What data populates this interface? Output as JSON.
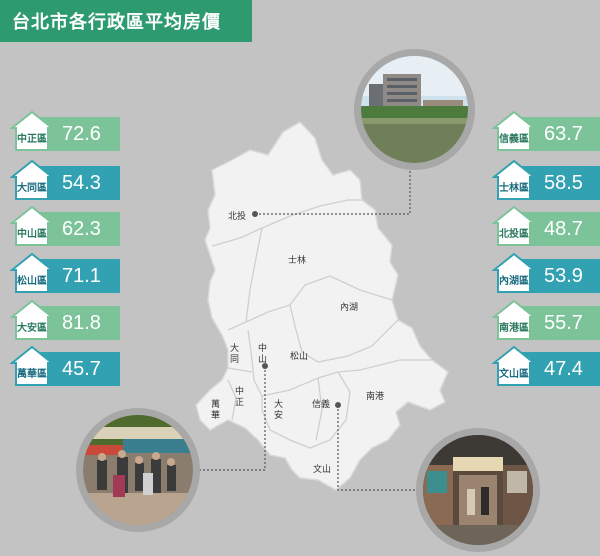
{
  "title": "台北市各行政區平均房價",
  "left_items": [
    {
      "name": "中正區",
      "value": "72.6",
      "color": "#7cc39a"
    },
    {
      "name": "大同區",
      "value": "54.3",
      "color": "#32a1b1"
    },
    {
      "name": "中山區",
      "value": "62.3",
      "color": "#7cc39a"
    },
    {
      "name": "松山區",
      "value": "71.1",
      "color": "#32a1b1"
    },
    {
      "name": "大安區",
      "value": "81.8",
      "color": "#7cc39a"
    },
    {
      "name": "萬華區",
      "value": "45.7",
      "color": "#32a1b1"
    }
  ],
  "right_items": [
    {
      "name": "信義區",
      "value": "63.7",
      "color": "#7cc39a"
    },
    {
      "name": "士林區",
      "value": "58.5",
      "color": "#32a1b1"
    },
    {
      "name": "北投區",
      "value": "48.7",
      "color": "#7cc39a"
    },
    {
      "name": "內湖區",
      "value": "53.9",
      "color": "#32a1b1"
    },
    {
      "name": "南港區",
      "value": "55.7",
      "color": "#7cc39a"
    },
    {
      "name": "文山區",
      "value": "47.4",
      "color": "#32a1b1"
    }
  ],
  "map_labels": {
    "beitou": "北投",
    "shilin": "士林",
    "neihu": "內湖",
    "datong": "大同",
    "zhongshan": "中山",
    "songshan": "松山",
    "nangang": "南港",
    "wanhua": "萬華",
    "zhongzheng": "中正",
    "daan": "大安",
    "xinyi": "信義",
    "wenshan": "文山"
  },
  "colors": {
    "background": "#c3c3c3",
    "title_bg": "#2e9a6f",
    "map_fill": "#f2f2f2",
    "light_green": "#7cc39a",
    "teal": "#32a1b1"
  }
}
